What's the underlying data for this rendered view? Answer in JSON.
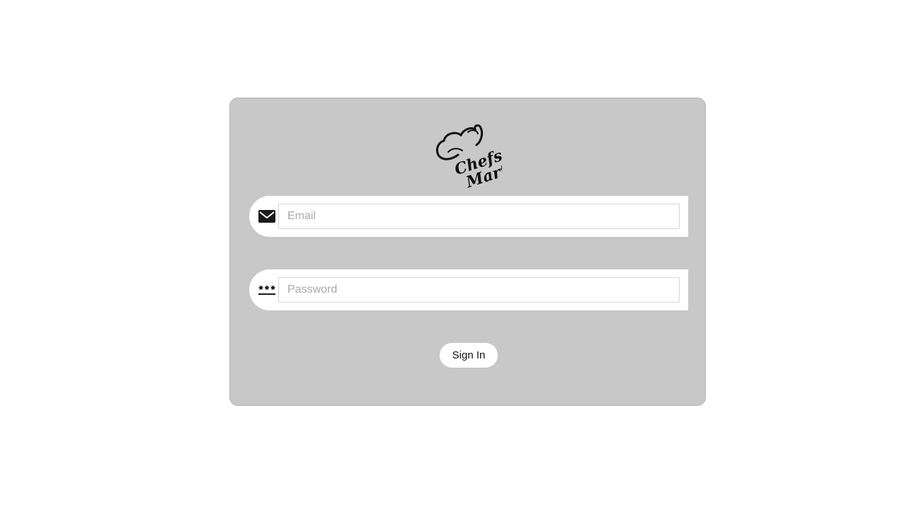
{
  "logo": {
    "name": "Chefs Mart",
    "line1": "Chefs",
    "line2": "Mart",
    "icon": "chef-hat-logo"
  },
  "form": {
    "email": {
      "icon": "envelope-icon",
      "placeholder": "Email",
      "value": ""
    },
    "password": {
      "icon": "password-asterisks-icon",
      "placeholder": "Password",
      "value": ""
    },
    "submit_label": "Sign In"
  },
  "colors": {
    "card_background": "#c8c8c8",
    "page_background": "#ffffff",
    "field_background": "#ffffff"
  }
}
